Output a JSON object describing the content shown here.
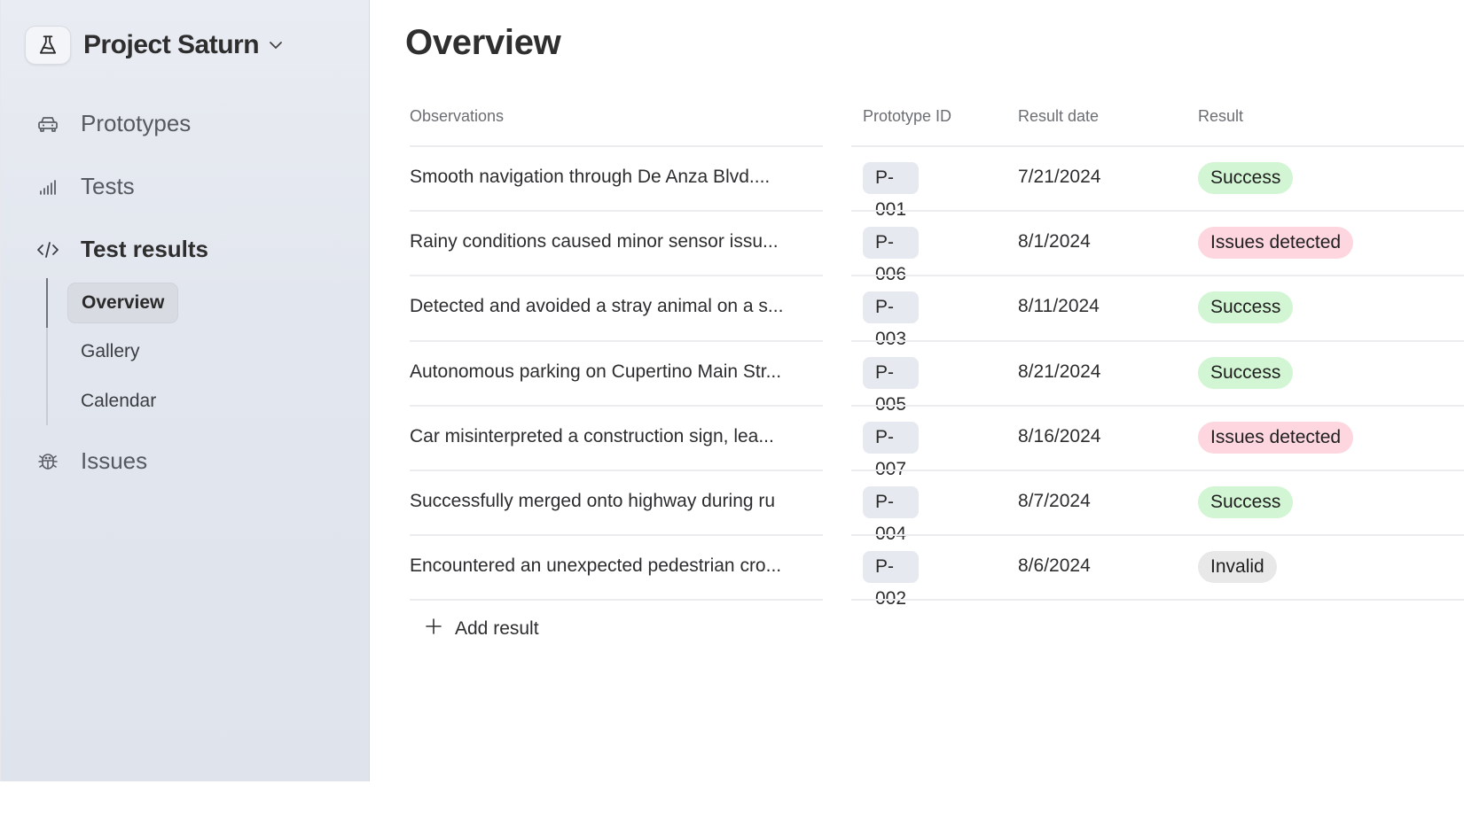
{
  "sidebar": {
    "project": {
      "name": "Project Saturn",
      "logo_icon": "flask-icon",
      "dropdown_icon": "chevron-down-icon"
    },
    "nav": [
      {
        "label": "Prototypes",
        "icon": "car-icon",
        "active": false
      },
      {
        "label": "Tests",
        "icon": "signal-bars-icon",
        "active": false
      },
      {
        "label": "Test results",
        "icon": "code-icon",
        "active": true
      },
      {
        "label": "Issues",
        "icon": "bug-icon",
        "active": false
      }
    ],
    "sub_nav": [
      {
        "label": "Overview",
        "active": true
      },
      {
        "label": "Gallery",
        "active": false
      },
      {
        "label": "Calendar",
        "active": false
      }
    ]
  },
  "main": {
    "title": "Overview",
    "table": {
      "columns": [
        "Observations",
        "Prototype ID",
        "Result date",
        "Result"
      ],
      "rows": [
        {
          "observation": "Smooth navigation through De Anza Blvd....",
          "prototype_id": "P-001",
          "date": "7/21/2024",
          "result": "Success"
        },
        {
          "observation": "Rainy conditions caused minor sensor issu...",
          "prototype_id": "P-006",
          "date": "8/1/2024",
          "result": "Issues detected"
        },
        {
          "observation": "Detected and avoided a stray animal on a s...",
          "prototype_id": "P-003",
          "date": "8/11/2024",
          "result": "Success"
        },
        {
          "observation": "Autonomous parking on Cupertino Main Str...",
          "prototype_id": "P-005",
          "date": "8/21/2024",
          "result": "Success"
        },
        {
          "observation": "Car misinterpreted a construction sign, lea...",
          "prototype_id": "P-007",
          "date": "8/16/2024",
          "result": "Issues detected"
        },
        {
          "observation": "Successfully merged onto highway during ru",
          "prototype_id": "P-004",
          "date": "8/7/2024",
          "result": "Success"
        },
        {
          "observation": "Encountered an unexpected pedestrian cro...",
          "prototype_id": "P-002",
          "date": "8/6/2024",
          "result": "Invalid"
        }
      ]
    },
    "add_result_label": "Add result",
    "add_icon": "plus-icon"
  },
  "colors": {
    "success_bg": "#d2f5d3",
    "issues_bg": "#fdd6df",
    "invalid_bg": "#e8e8e8",
    "prototype_id_bg": "#e6e9ef",
    "sidebar_bg": "#e3e7ee"
  }
}
